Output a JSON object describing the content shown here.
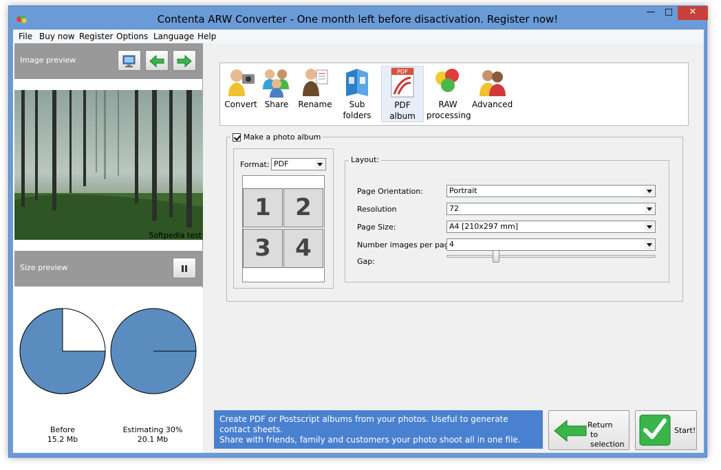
{
  "window": {
    "title": "Contenta ARW Converter  - One month left before disactivation. Register now!",
    "controls": {
      "minimize": "—",
      "maximize": "□",
      "close": "✕"
    }
  },
  "menu": [
    "File",
    "Buy now",
    "Register",
    "Options",
    "Language",
    "Help"
  ],
  "image_preview": {
    "label": "Image preview",
    "watermark_text": "Softpedia test",
    "buttons": [
      "monitor-icon",
      "arrow-left-icon",
      "arrow-right-icon"
    ]
  },
  "size_preview": {
    "label": "Size preview",
    "pause_icon": "pause-icon",
    "before": {
      "label": "Before",
      "value": "15.2 Mb",
      "fraction_unfilled": 0.25
    },
    "after": {
      "label": "Estimating 30%",
      "value": "20.1 Mb"
    },
    "pie_color": "#5b8cbf"
  },
  "toolbar": [
    {
      "label": "Convert",
      "icon": "convert-icon"
    },
    {
      "label": "Share",
      "icon": "share-icon"
    },
    {
      "label": "Rename",
      "icon": "rename-icon"
    },
    {
      "label": "Sub folders",
      "icon": "subfolders-icon"
    },
    {
      "label": "PDF album",
      "icon": "pdf-album-icon",
      "active": true
    },
    {
      "label": "RAW processing",
      "icon": "raw-processing-icon"
    },
    {
      "label": "Advanced",
      "icon": "advanced-icon"
    }
  ],
  "album": {
    "make_album_label": "Make a photo album",
    "make_album_checked": true,
    "format_label": "Format:",
    "format_value": "PDF",
    "grid_numbers": [
      "1",
      "2",
      "3",
      "4"
    ]
  },
  "layout": {
    "label": "Layout:",
    "orientation_label": "Page Orientation:",
    "orientation_value": "Portrait",
    "resolution_label": "Resolution",
    "resolution_value": "72",
    "page_size_label": "Page Size:",
    "page_size_value": "A4 [210x297 mm]",
    "images_per_page_label": "Number images per page:",
    "images_per_page_value": "4",
    "gap_label": "Gap:"
  },
  "description": {
    "line1": "Create PDF or Postscript albums from your photos. Useful to generate contact sheets.",
    "line2": "Share with friends, family and customers your photo shoot all in one file."
  },
  "actions": {
    "return_line1": "Return",
    "return_line2": "to selection",
    "start": "Start!"
  },
  "colors": {
    "accent_blue": "#4a80d0",
    "header_gray": "#999999",
    "pie_blue": "#5b8cbf"
  }
}
